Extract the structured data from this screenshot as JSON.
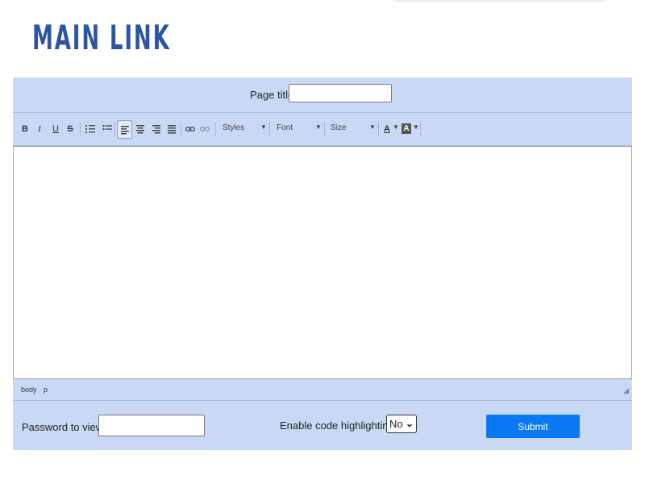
{
  "logo": {
    "text": "MAIN LINK",
    "color": "#2c55a3"
  },
  "form": {
    "page_title_label": "Page title",
    "page_title_value": "",
    "password_label": "Password to view ?",
    "password_value": "",
    "highlight_label": "Enable code highlighting ?",
    "highlight_value": "No",
    "submit_label": "Submit"
  },
  "toolbar": {
    "bold": "B",
    "italic": "I",
    "underline": "U",
    "strike": "S",
    "styles": "Styles",
    "font": "Font",
    "size": "Size",
    "text_color": "A",
    "bg_color": "A"
  },
  "editor": {
    "content": ""
  },
  "status_path": [
    "body",
    "p"
  ],
  "colors": {
    "panel": "#c9d8f5",
    "submit": "#0a78f2"
  }
}
